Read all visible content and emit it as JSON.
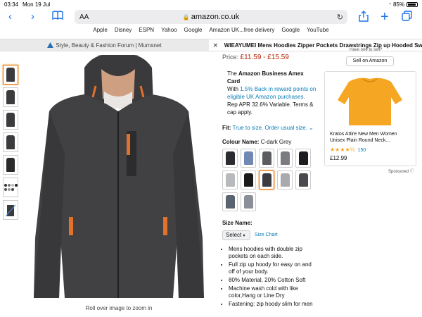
{
  "status": {
    "time": "03:34",
    "date": "Mon 19 Jul",
    "battery": "85%"
  },
  "toolbar": {
    "text_size": "AA",
    "url": "amazon.co.uk"
  },
  "bookmarks": [
    "Apple",
    "Disney",
    "ESPN",
    "Yahoo",
    "Google",
    "Amazon UK...free delivery",
    "Google",
    "YouTube"
  ],
  "tabs": {
    "forum": "Style, Beauty & Fashion Forum | Mumsnet",
    "product": "WIEAYUMEI Mens Hoodies Zipper Pockets Drawstrings Zip up Hooded Sw..."
  },
  "hero": {
    "caption": "Roll over image to zoom in"
  },
  "product": {
    "price_label": "Price:",
    "price": "£11.59 - £15.59",
    "amex_line1_pre": "The ",
    "amex_bold": "Amazon Business Amex Card",
    "amex_with": "With ",
    "amex_link": "1.5% Back in reward points on eligible UK Amazon purchases.",
    "amex_rep": "Rep APR 32.6% Variable. Terms & cap apply.",
    "fit_label": "Fit:",
    "fit_link": "True to size. Order usual size.",
    "colour_label": "Colour Name:",
    "colour_value": "C-dark Grey",
    "size_label": "Size Name:",
    "size_select": "Select",
    "size_chart": "Size Chart",
    "bullets": [
      "Mens hoodies with double zip pockets on each side.",
      "Full zip up hoody for easy on and off of your body.",
      "80% Material, 20% Cotton Soft",
      "Machine wash cold with like color,Hang or Line Dry",
      "Fastening: zip hoody slim for men"
    ]
  },
  "swatch_colors": [
    "#2b2c2f",
    "#6f88b4",
    "#5c5d60",
    "#7a7c80",
    "#1c1d20",
    "#b8b9bc",
    "#1a1a1a",
    "#3b3c40",
    "#a9aaad",
    "#484a4e",
    "#5a6370",
    "#8a8f98"
  ],
  "ad": {
    "have_one": "Have one to sell?",
    "sell_button": "Sell on Amazon",
    "title": "Kratos Attire New Men Women Unisex Plain Round Neck...",
    "stars": "★★★★½",
    "rating_count": "150",
    "price": "£12.99",
    "sponsored": "Sponsored"
  },
  "colors": {
    "accent": "#1a73e8",
    "price_red": "#b12704",
    "link": "#0a7db8",
    "selected": "#e77600"
  }
}
